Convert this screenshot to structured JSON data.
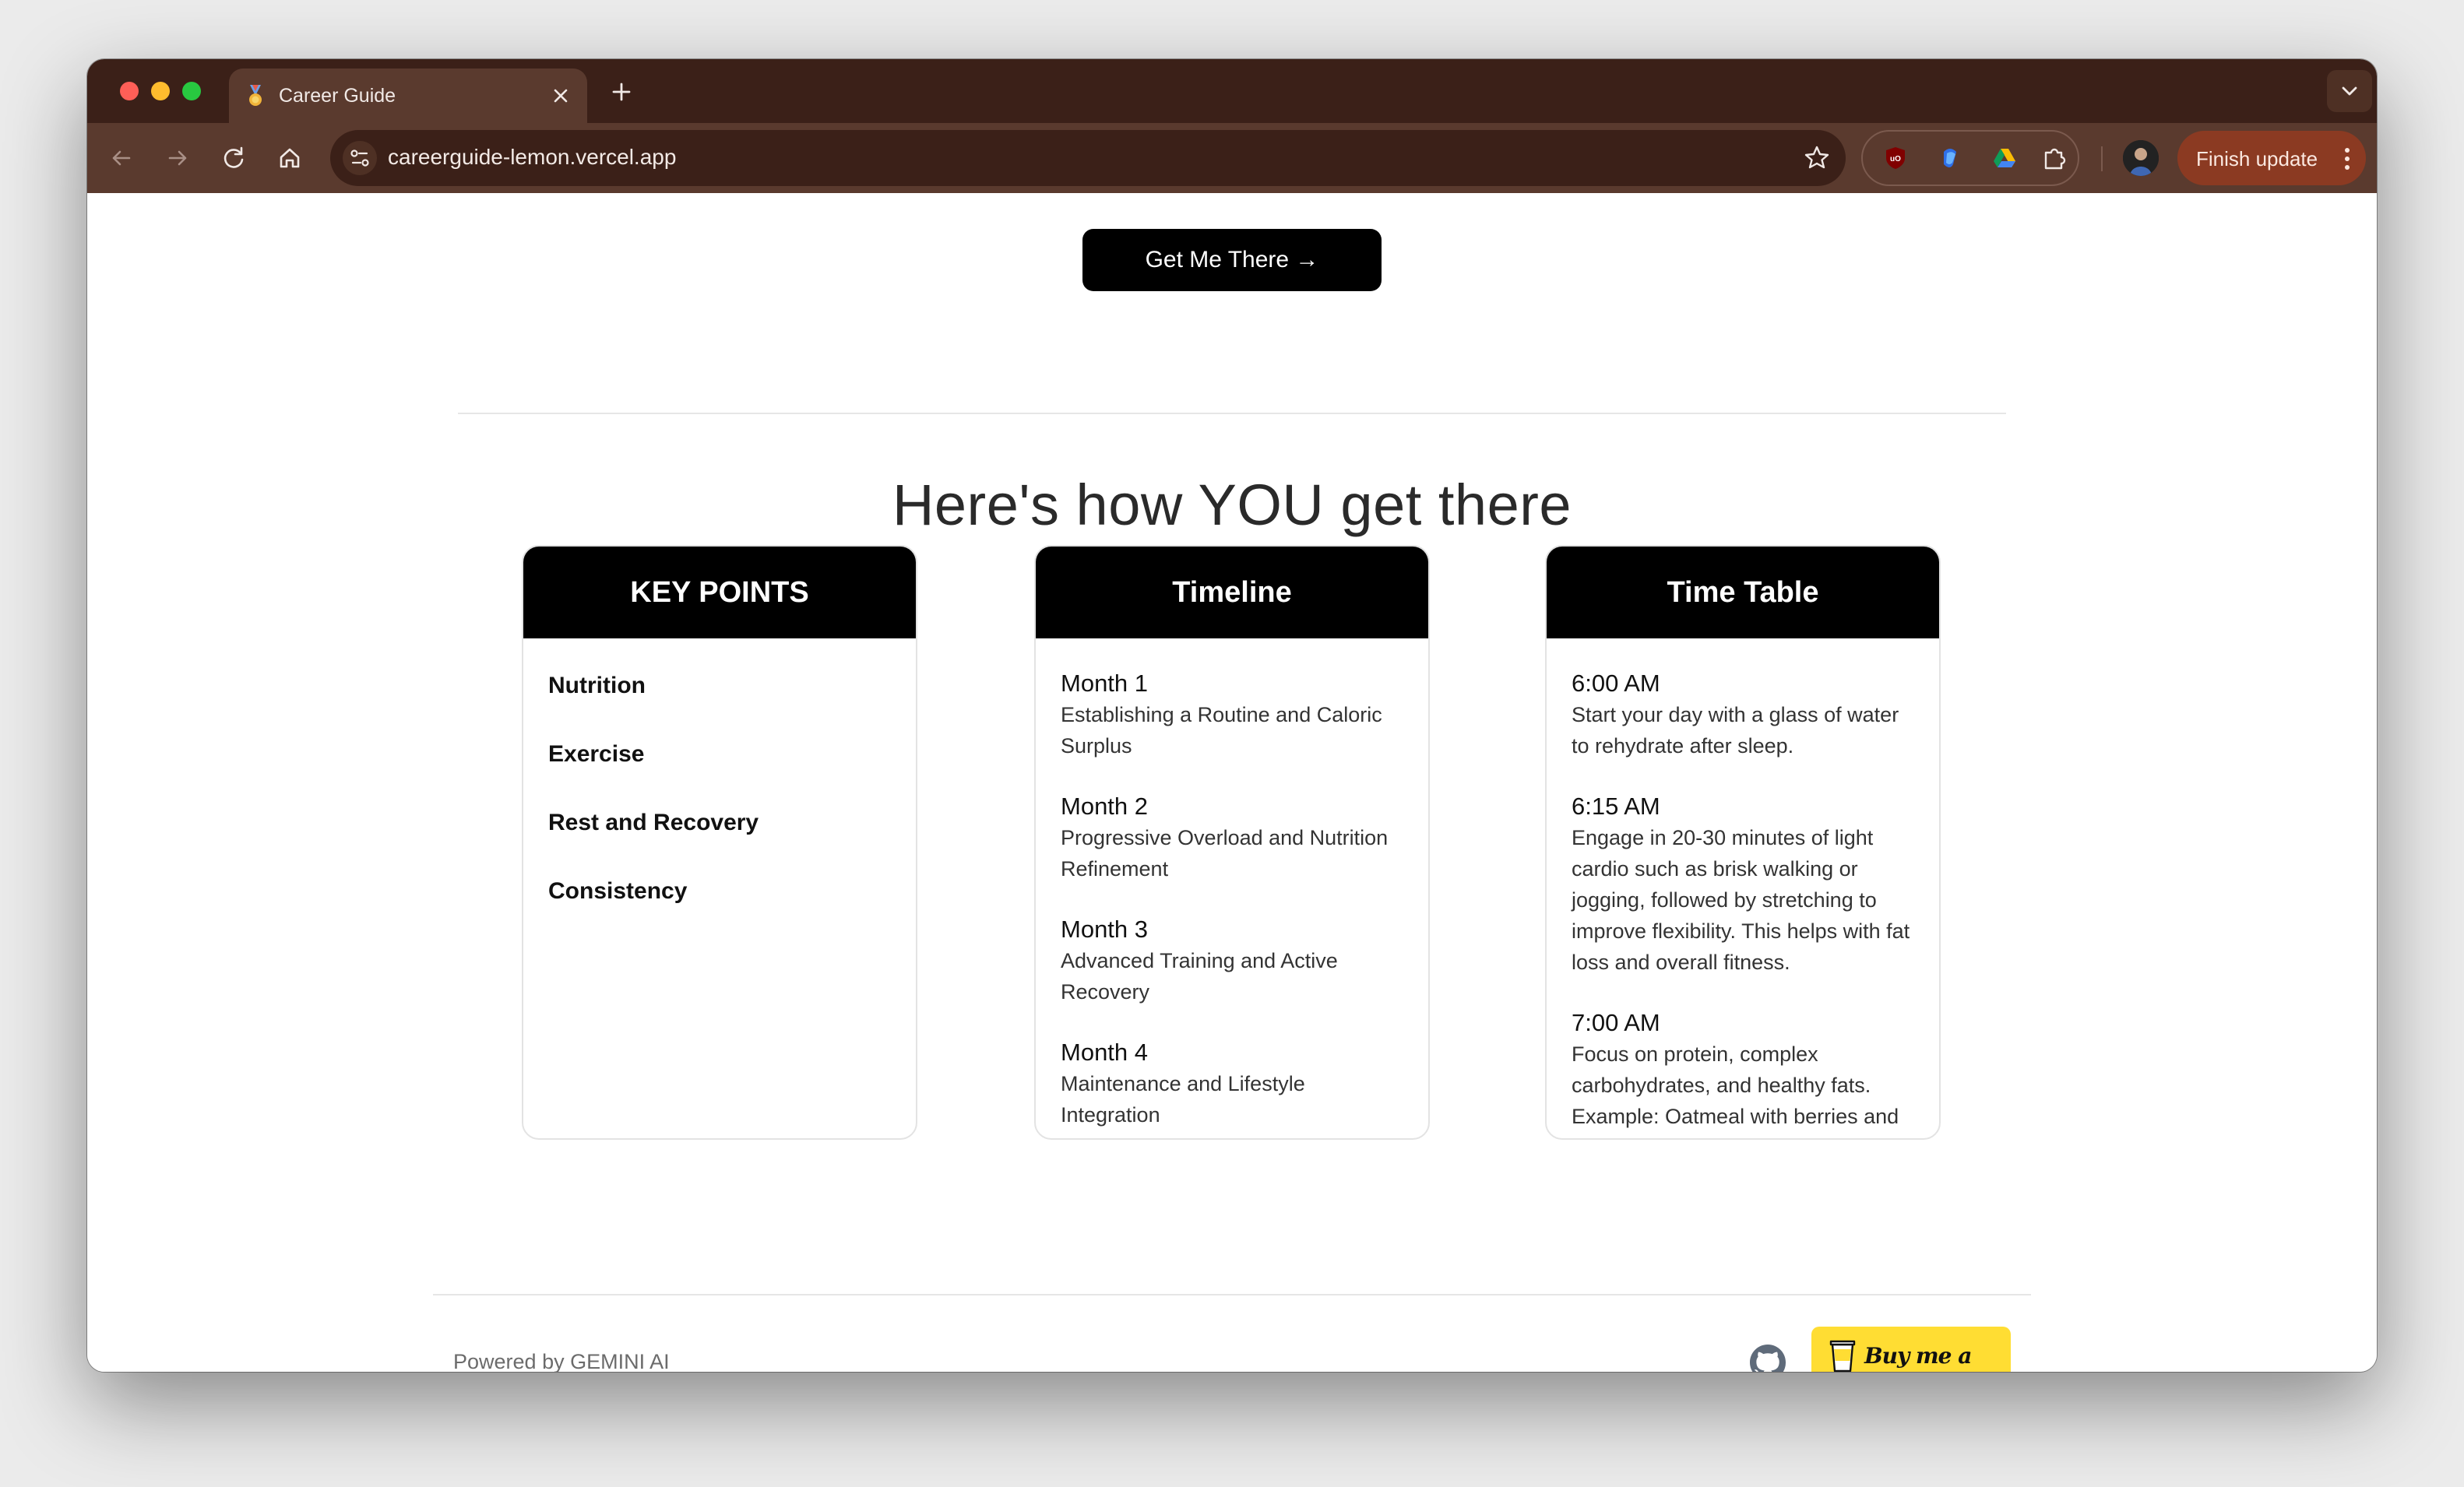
{
  "browser": {
    "tab_title": "Career Guide",
    "url": "careerguide-lemon.vercel.app",
    "finish_update_label": "Finish update",
    "extensions": [
      "ublock-icon",
      "copilot-icon",
      "google-drive-icon",
      "puzzle-icon"
    ]
  },
  "page": {
    "cta_label": "Get Me There →",
    "heading": "Here's how YOU get there",
    "key_points": {
      "title": "KEY POINTS",
      "items": [
        "Nutrition",
        "Exercise",
        "Rest and Recovery",
        "Consistency"
      ]
    },
    "timeline": {
      "title": "Timeline",
      "items": [
        {
          "title": "Month 1",
          "desc": "Establishing a Routine and Caloric Surplus"
        },
        {
          "title": "Month 2",
          "desc": "Progressive Overload and Nutrition Refinement"
        },
        {
          "title": "Month 3",
          "desc": "Advanced Training and Active Recovery"
        },
        {
          "title": "Month 4",
          "desc": "Maintenance and Lifestyle Integration"
        }
      ]
    },
    "time_table": {
      "title": "Time Table",
      "items": [
        {
          "title": "6:00 AM",
          "desc": "Start your day with a glass of water to rehydrate after sleep."
        },
        {
          "title": "6:15 AM",
          "desc": "Engage in 20-30 minutes of light cardio such as brisk walking or jogging, followed by stretching to improve flexibility. This helps with fat loss and overall fitness."
        },
        {
          "title": "7:00 AM",
          "desc": "Focus on protein, complex carbohydrates, and healthy fats. Example: Oatmeal with berries and nuts."
        }
      ]
    },
    "footer": {
      "powered_by": "Powered by GEMINI AI",
      "coffee_label": "Buy me a coffee"
    }
  },
  "colors": {
    "chrome_dark": "#3b2018",
    "chrome_toolbar": "#5a3a2e",
    "finish_update": "#8b3a22",
    "coffee_yellow": "#ffdd33"
  }
}
